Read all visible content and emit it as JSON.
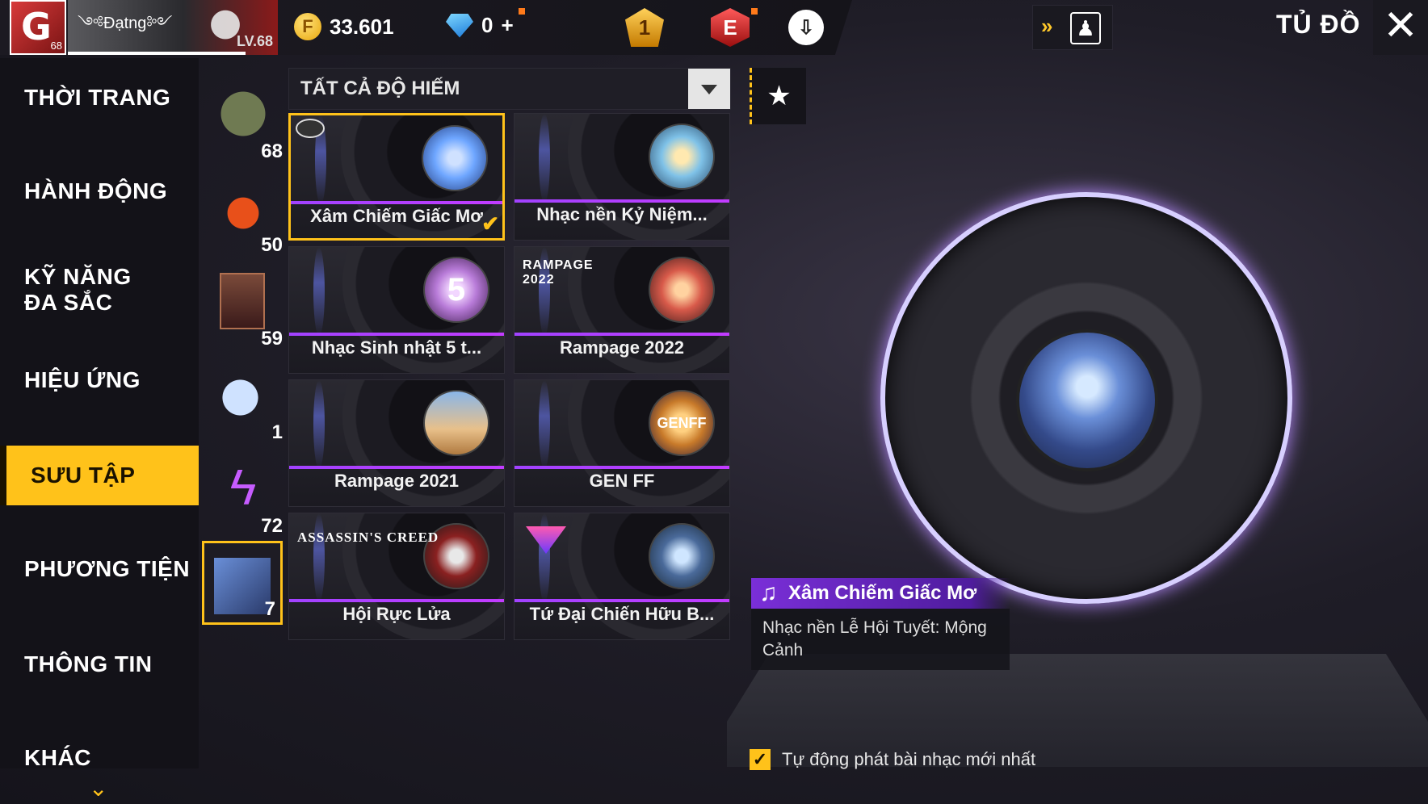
{
  "header": {
    "player_name": "༺Đạtng༻",
    "player_level": "LV.68",
    "avatar_level": "68",
    "avatar_letter": "G",
    "gold": "33.601",
    "diamonds": "0",
    "diamonds_add": "+",
    "rank_badge": "1",
    "elite_badge": "E",
    "title": "TỦ ĐỒ",
    "close_label": "✕"
  },
  "sidebar": {
    "items": [
      {
        "label": "THỜI TRANG"
      },
      {
        "label": "HÀNH ĐỘNG"
      },
      {
        "label": "KỸ NĂNG ĐA SẮC"
      },
      {
        "label": "HIỆU ỨNG"
      },
      {
        "label": "SƯU TẬP"
      },
      {
        "label": "PHƯƠNG TIỆN"
      },
      {
        "label": "THÔNG TIN"
      },
      {
        "label": "KHÁC"
      }
    ]
  },
  "subcategories": [
    {
      "count": "68",
      "icon": "parachute-icon"
    },
    {
      "count": "50",
      "icon": "mascot-icon"
    },
    {
      "count": "59",
      "icon": "avatar-card-icon"
    },
    {
      "count": "1",
      "icon": "feather-icon"
    },
    {
      "count": "72",
      "icon": "lightning-icon"
    },
    {
      "count": "7",
      "icon": "music-album-icon"
    }
  ],
  "filter": {
    "label": "TẤT CẢ ĐỘ HIẾM"
  },
  "grid": [
    {
      "label": "Xâm Chiếm Giấc Mơ",
      "selected": true,
      "cover": "#6ea6ff"
    },
    {
      "label": "Nhạc nền Kỷ Niệm...",
      "selected": false,
      "cover": "#7fc2e8"
    },
    {
      "label": "Nhạc Sinh nhật 5 t...",
      "selected": false,
      "cover": "#b87bd8",
      "badge": "5"
    },
    {
      "label": "Rampage 2022",
      "selected": false,
      "cover": "#d85a4a",
      "logo": "RAMPAGE 2022"
    },
    {
      "label": "Rampage 2021",
      "selected": false,
      "cover": "#e8c08a"
    },
    {
      "label": "GEN FF",
      "selected": false,
      "cover": "#c87a2a",
      "badge": "GENFF"
    },
    {
      "label": "Hội Rực Lửa",
      "selected": false,
      "cover": "#8a2020",
      "logo": "ASSASSIN'S CREED"
    },
    {
      "label": "Tứ Đại Chiến Hữu B...",
      "selected": false,
      "cover": "#4a6a9a"
    }
  ],
  "preview": {
    "title": "Xâm Chiếm Giấc Mơ",
    "description": "Nhạc nền Lễ Hội Tuyết: Mộng Cảnh",
    "autoplay_label": "Tự động phát bài nhạc mới nhất",
    "autoplay_checked": true
  },
  "colors": {
    "accent": "#ffc21a",
    "purple": "#a142ff"
  }
}
